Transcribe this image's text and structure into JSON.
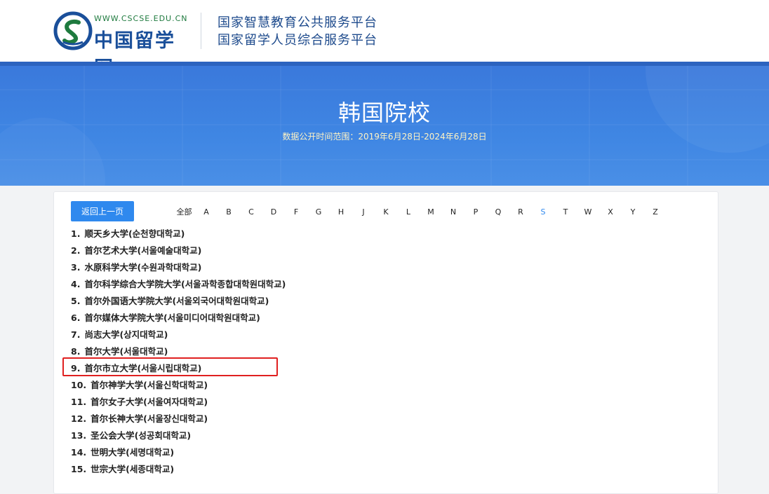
{
  "header": {
    "logo_url_text": "WWW.CSCSE.EDU.CN",
    "logo_name": "中国留学网",
    "platform_line1": "国家智慧教育公共服务平台",
    "platform_line2": "国家留学人员综合服务平台"
  },
  "banner": {
    "title": "韩国院校",
    "subtitle": "数据公开时间范围：2019年6月28日-2024年6月28日"
  },
  "nav": {
    "back_label": "返回上一页",
    "letters": [
      "全部",
      "A",
      "B",
      "C",
      "D",
      "F",
      "G",
      "H",
      "J",
      "K",
      "L",
      "M",
      "N",
      "P",
      "Q",
      "R",
      "S",
      "T",
      "W",
      "X",
      "Y",
      "Z"
    ],
    "active_letter": "S"
  },
  "schools": [
    {
      "num": "1.",
      "name": "顺天乡大学(순천향대학교)"
    },
    {
      "num": "2.",
      "name": "首尔艺术大学(서울예술대학교)"
    },
    {
      "num": "3.",
      "name": "水原科学大学(수원과학대학교)"
    },
    {
      "num": "4.",
      "name": "首尔科学综合大学院大学(서울과학종합대학원대학교)"
    },
    {
      "num": "5.",
      "name": "首尔外国语大学院大学(서울외국어대학원대학교)"
    },
    {
      "num": "6.",
      "name": "首尔媒体大学院大学(서울미디어대학원대학교)"
    },
    {
      "num": "7.",
      "name": "尚志大学(상지대학교)"
    },
    {
      "num": "8.",
      "name": "首尔大学(서울대학교)"
    },
    {
      "num": "9.",
      "name": "首尔市立大学(서울시립대학교)"
    },
    {
      "num": "10.",
      "name": "首尔神学大学(서울신학대학교)"
    },
    {
      "num": "11.",
      "name": "首尔女子大学(서울여자대학교)"
    },
    {
      "num": "12.",
      "name": "首尔长神大学(서울장신대학교)"
    },
    {
      "num": "13.",
      "name": "圣公会大学(성공회대학교)"
    },
    {
      "num": "14.",
      "name": "世明大学(세명대학교)"
    },
    {
      "num": "15.",
      "name": "世宗大学(세종대학교)"
    }
  ],
  "colors": {
    "accent": "#2f89ee",
    "banner_blue": "#3f86e3",
    "highlight": "#e02020"
  }
}
